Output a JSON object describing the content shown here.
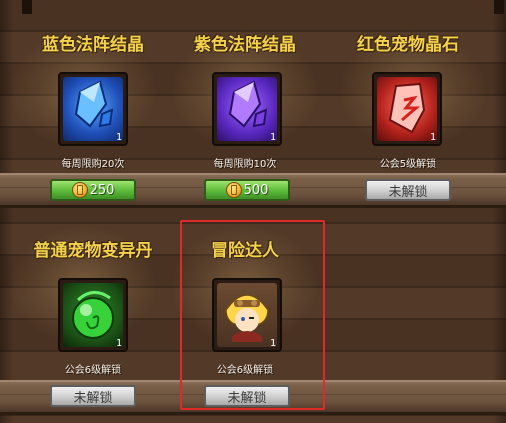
{
  "shop": {
    "items": [
      {
        "name": "蓝色法阵结晶",
        "count": "1",
        "requirement": "每周限购20次",
        "button": {
          "type": "price",
          "label": "250"
        },
        "icon": "blue-crystal-icon"
      },
      {
        "name": "紫色法阵结晶",
        "count": "1",
        "requirement": "每周限购10次",
        "button": {
          "type": "price",
          "label": "500"
        },
        "icon": "purple-crystal-icon"
      },
      {
        "name": "红色宠物晶石",
        "count": "1",
        "requirement": "公会5级解锁",
        "button": {
          "type": "locked",
          "label": "未解锁"
        },
        "icon": "red-pet-gem-icon"
      },
      {
        "name": "普通宠物变异丹",
        "count": "1",
        "requirement": "公会6级解锁",
        "button": {
          "type": "locked",
          "label": "未解锁"
        },
        "icon": "green-pet-mutation-orb-icon"
      },
      {
        "name": "冒险达人",
        "count": "1",
        "requirement": "公会6级解锁",
        "button": {
          "type": "locked",
          "label": "未解锁"
        },
        "icon": "adventurer-avatar-icon"
      }
    ]
  },
  "colors": {
    "title": "#f4d24c",
    "price_button": "#5cba3a",
    "locked_button": "#cfcfcf",
    "highlight_box": "#e02a2a"
  }
}
